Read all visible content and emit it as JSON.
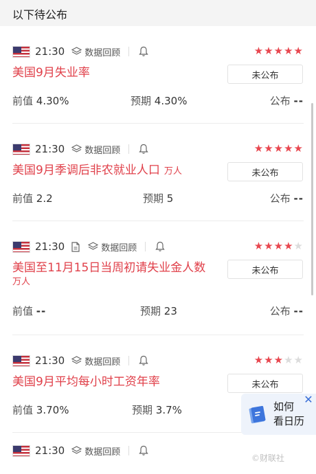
{
  "header": {
    "title": "以下待公布"
  },
  "labels": {
    "prev": "前值",
    "forecast": "预期",
    "published": "公布",
    "replay": "数据回顾"
  },
  "colors": {
    "accent": "#e0404a",
    "star_on": "#e8474f",
    "star_off": "#dcdcdc",
    "flag_blue": "#3c3b6e",
    "flag_red": "#c4303c"
  },
  "events": [
    {
      "time": "21:30",
      "country_icon": "us-flag-icon",
      "has_doc": false,
      "importance": 5,
      "stars": [
        "★",
        "★",
        "★",
        "★",
        "★"
      ],
      "name": "美国9月失业率",
      "unit": "",
      "status": "未公布",
      "prev": "4.30%",
      "forecast": "4.30%",
      "actual": "--"
    },
    {
      "time": "21:30",
      "country_icon": "us-flag-icon",
      "has_doc": false,
      "importance": 5,
      "stars": [
        "★",
        "★",
        "★",
        "★",
        "★"
      ],
      "name": "美国9月季调后非农就业人口",
      "unit": "万人",
      "status": "未公布",
      "prev": "2.2",
      "forecast": "5",
      "actual": "--"
    },
    {
      "time": "21:30",
      "country_icon": "us-flag-icon",
      "has_doc": true,
      "importance": 4,
      "stars": [
        "★",
        "★",
        "★",
        "★",
        "★"
      ],
      "name": "美国至11月15日当周初请失业金人数",
      "unit": "万人",
      "status": "未公布",
      "prev": "--",
      "forecast": "23",
      "actual": "--"
    },
    {
      "time": "21:30",
      "country_icon": "us-flag-icon",
      "has_doc": false,
      "importance": 3,
      "stars": [
        "★",
        "★",
        "★",
        "★",
        "★"
      ],
      "name": "美国9月平均每小时工资年率",
      "unit": "",
      "status": "未公布",
      "prev": "3.70%",
      "forecast": "3.7%",
      "actual": ""
    },
    {
      "time": "21:30",
      "country_icon": "us-flag-icon",
      "has_doc": false,
      "importance": 0,
      "stars": [],
      "name": "",
      "unit": "",
      "status": "",
      "prev": "",
      "forecast": "",
      "actual": ""
    }
  ],
  "float_widget": {
    "line1": "如何",
    "line2": "看日历",
    "close": "✕"
  },
  "watermark": "©财联社"
}
